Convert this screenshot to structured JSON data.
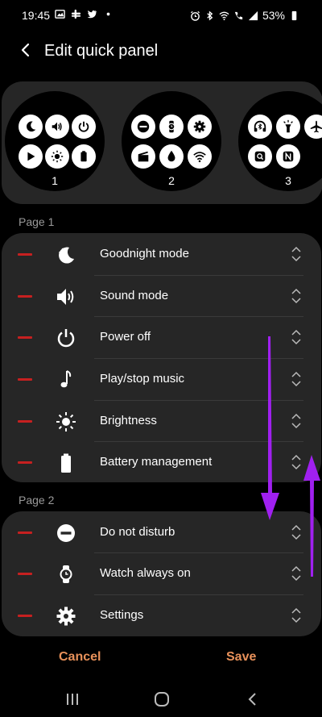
{
  "status_bar": {
    "time": "19:45",
    "battery": "53%",
    "left_icons": [
      "image-icon",
      "slack-icon",
      "twitter-icon",
      "dot-icon"
    ],
    "right_icons": [
      "alarm-icon",
      "bluetooth-icon",
      "wifi-icon",
      "wifi-call-icon",
      "signal-icon",
      "battery-icon"
    ]
  },
  "header": {
    "title": "Edit quick panel"
  },
  "preview": {
    "pages": [
      {
        "number": "1",
        "icons": [
          "moon-icon",
          "volume-icon",
          "power-icon",
          "play-icon",
          "brightness-icon",
          "battery-icon"
        ]
      },
      {
        "number": "2",
        "icons": [
          "minus-circle-icon",
          "watch-icon",
          "gear-icon",
          "clapper-icon",
          "water-drop-icon",
          "wifi-icon"
        ]
      },
      {
        "number": "3",
        "icons": [
          "headphone-bluetooth-icon",
          "flashlight-icon",
          "airplane-icon",
          "search-app-icon",
          "nfc-icon"
        ]
      }
    ]
  },
  "page1": {
    "label": "Page 1",
    "items": [
      {
        "label": "Goodnight mode",
        "icon": "moon-icon"
      },
      {
        "label": "Sound mode",
        "icon": "volume-icon"
      },
      {
        "label": "Power off",
        "icon": "power-icon"
      },
      {
        "label": "Play/stop music",
        "icon": "music-note-icon"
      },
      {
        "label": "Brightness",
        "icon": "brightness-icon"
      },
      {
        "label": "Battery management",
        "icon": "battery-icon"
      }
    ]
  },
  "page2": {
    "label": "Page 2",
    "items": [
      {
        "label": "Do not disturb",
        "icon": "minus-circle-icon"
      },
      {
        "label": "Watch always on",
        "icon": "watch-icon"
      },
      {
        "label": "Settings",
        "icon": "gear-icon"
      }
    ]
  },
  "footer": {
    "cancel": "Cancel",
    "save": "Save"
  },
  "colors": {
    "accent": "#e8915a",
    "remove": "#c62020",
    "annotation_arrow": "#a020f0",
    "card": "#262626"
  }
}
